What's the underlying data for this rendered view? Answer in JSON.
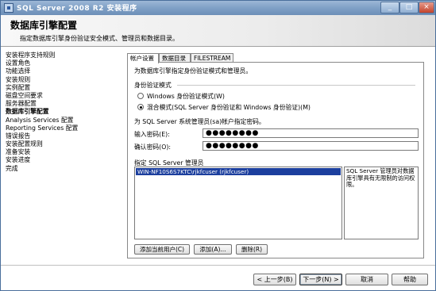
{
  "window": {
    "title": "SQL Server 2008 R2 安装程序"
  },
  "header": {
    "title": "数据库引擎配置",
    "subtitle": "指定数据库引擎身份验证安全模式、管理员和数据目录。"
  },
  "nav": {
    "items": [
      {
        "label": "安装程序支持规则"
      },
      {
        "label": "设置角色"
      },
      {
        "label": "功能选择"
      },
      {
        "label": "安装规则"
      },
      {
        "label": "实例配置"
      },
      {
        "label": "磁盘空间要求"
      },
      {
        "label": "服务器配置"
      },
      {
        "label": "数据库引擎配置"
      },
      {
        "label": "Analysis Services 配置"
      },
      {
        "label": "Reporting Services 配置"
      },
      {
        "label": "错误报告"
      },
      {
        "label": "安装配置规则"
      },
      {
        "label": "准备安装"
      },
      {
        "label": "安装进度"
      },
      {
        "label": "完成"
      }
    ],
    "current": "数据库引擎配置"
  },
  "tabs": [
    {
      "label": "帐户设置"
    },
    {
      "label": "数据目录"
    },
    {
      "label": "FILESTREAM"
    }
  ],
  "account": {
    "description": "为数据库引擎指定身份验证模式和管理员。",
    "auth_mode_label": "身份验证模式",
    "windows_mode_label": "Windows 身份验证模式(W)",
    "mixed_mode_label": "混合模式(SQL Server 身份验证和 Windows 身份验证)(M)",
    "selected_mode": "mixed",
    "sa_prompt": "为 SQL Server 系统管理员(sa)帐户指定密码。",
    "password_label": "输入密码(E):",
    "password_value": "●●●●●●●●",
    "confirm_label": "确认密码(O):",
    "confirm_value": "●●●●●●●●",
    "admins_label": "指定 SQL Server 管理员",
    "admins": [
      "WIN-NF10S6S7KTC\\rjkfcuser (rjkfcuser)"
    ],
    "admins_info": "SQL Server 管理员对数据库引擎具有无限制的访问权限。",
    "add_current_button": "添加当前用户(C)",
    "add_button": "添加(A)...",
    "remove_button": "删除(R)"
  },
  "footer": {
    "back_button": "< 上一步(B)",
    "next_button": "下一步(N) >",
    "cancel_button": "取消",
    "help_button": "帮助"
  }
}
